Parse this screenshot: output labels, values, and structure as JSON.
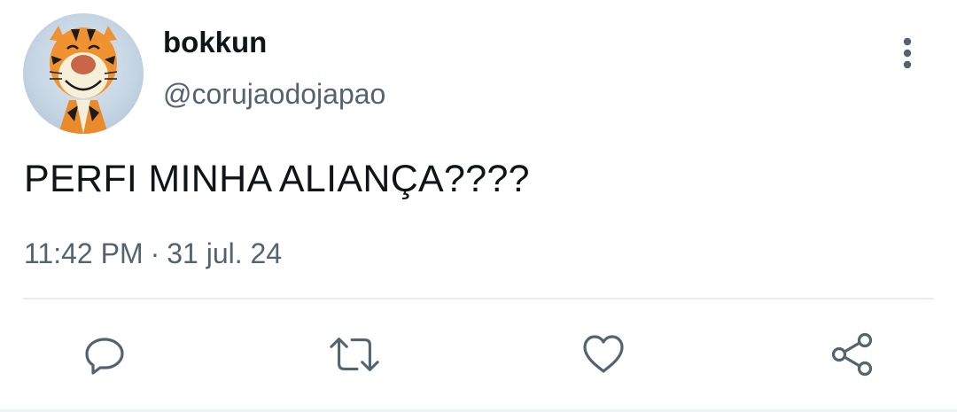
{
  "tweet": {
    "author": {
      "display_name": "bokkun",
      "handle": "@corujaodojapao",
      "avatar_icon": "tigger-avatar-icon"
    },
    "text": "PERFI MINHA ALIANÇA????",
    "time": "11:42 PM",
    "separator": "·",
    "date": "31 jul. 24"
  },
  "actions": {
    "more_icon": "more-vertical-icon",
    "reply_icon": "reply-icon",
    "retweet_icon": "retweet-icon",
    "like_icon": "heart-icon",
    "share_icon": "share-icon"
  },
  "colors": {
    "text_primary": "#0f1419",
    "text_secondary": "#536471",
    "icon": "#536471",
    "divider": "#e6ecf0"
  }
}
